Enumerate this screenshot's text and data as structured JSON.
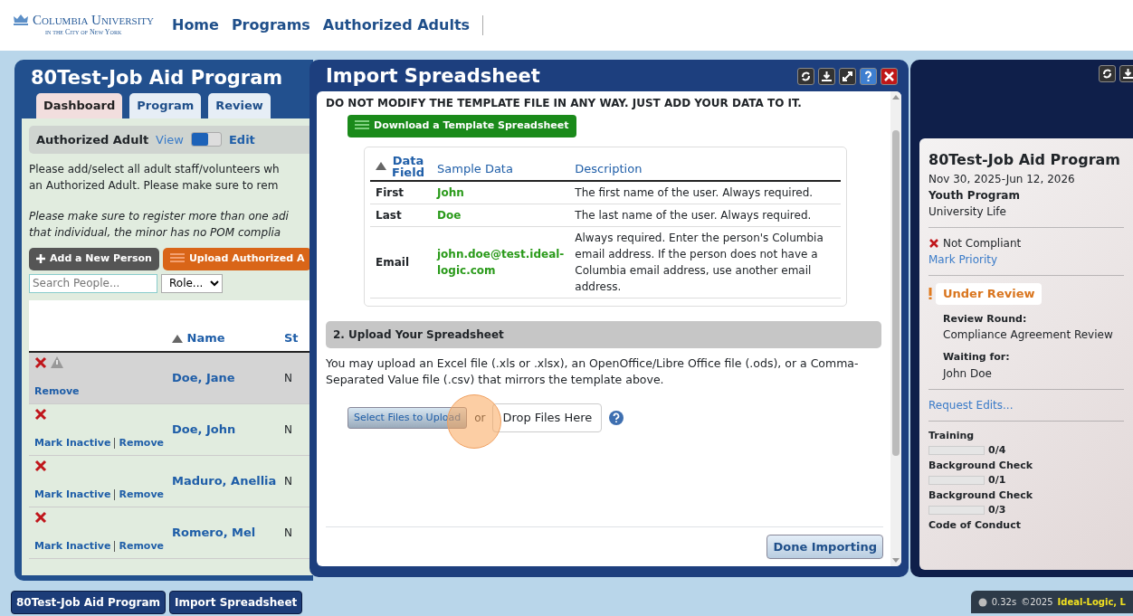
{
  "header": {
    "logo_name": "Columbia University",
    "logo_sub": "in the City of New York",
    "nav": [
      "Home",
      "Programs",
      "Authorized Adults"
    ]
  },
  "program_window": {
    "title": "80Test-Job Aid Program",
    "tabs": [
      {
        "label": "Dashboard",
        "selected": true
      },
      {
        "label": "Program",
        "selected": false
      },
      {
        "label": "Review",
        "selected": false
      }
    ],
    "section_title": "Authorized Adult",
    "toggle": {
      "left_label": "View",
      "right_label": "Edit",
      "on": false
    },
    "intro": "Please add/select all adult staff/volunteers wh\nan Authorized Adult. Please make sure to rem",
    "note": "Please make sure to register more than one adi\nthat individual, the minor has no POM complia",
    "buttons": [
      {
        "label": "Add a New Person",
        "kind": "add"
      },
      {
        "label": "Upload Authorized A",
        "kind": "upload"
      }
    ],
    "search": {
      "placeholder": "Search People..."
    },
    "role_select": "Role...",
    "columns": [
      "Name",
      "St"
    ],
    "rows": [
      {
        "name": "Doe, Jane",
        "column_3": "N",
        "warning": true,
        "actions": [
          "Remove"
        ],
        "selected": true
      },
      {
        "name": "Doe, John",
        "column_3": "N",
        "warning": false,
        "actions": [
          "Mark Inactive",
          "Remove"
        ],
        "selected": false
      },
      {
        "name": "Maduro, Anellia",
        "column_3": "N",
        "warning": false,
        "actions": [
          "Mark Inactive",
          "Remove"
        ],
        "selected": false
      },
      {
        "name": "Romero, Mel",
        "column_3": "N",
        "warning": false,
        "actions": [
          "Mark Inactive",
          "Remove"
        ],
        "selected": false
      }
    ]
  },
  "import_dialog": {
    "title": "Import Spreadsheet",
    "warning": "DO NOT MODIFY THE TEMPLATE FILE IN ANY WAY. JUST ADD YOUR DATA TO IT.",
    "download_button": "Download a Template Spreadsheet",
    "table": {
      "columns": [
        "Data Field",
        "Sample Data",
        "Description"
      ],
      "rows": [
        {
          "field": "First",
          "sample": "John",
          "description": "The first name of the user. Always required."
        },
        {
          "field": "Last",
          "sample": "Doe",
          "description": "The last name of the user. Always required."
        },
        {
          "field": "Email",
          "sample": "john.doe@test.ideal-logic.com",
          "description": "Always required. Enter the person's Columbia email address. If the person does not have a Columbia email address, use another email address."
        }
      ]
    },
    "step_title": "2. Upload Your Spreadsheet",
    "step_text": "You may upload an Excel file (.xls or .xlsx), an OpenOffice/Libre Office file (.ods), or a Comma-Separated Value file (.csv) that mirrors the template above.",
    "select_button": "Select Files to Upload",
    "or": "or",
    "drop_zone": "Drop Files Here",
    "done_button": "Done Importing"
  },
  "summary_window": {
    "program": "80Test-Job Aid Program",
    "dates": "Nov 30, 2025-Jun 12, 2026",
    "type": "Youth Program",
    "department": "University Life",
    "compliance": "Not Compliant",
    "mark_priority": "Mark Priority",
    "status": "Under Review",
    "review_round_label": "Review Round:",
    "review_round": "Compliance Agreement Review",
    "waiting_label": "Waiting for:",
    "waiting": "John Doe",
    "request_edits": "Request Edits...",
    "requirements": [
      {
        "name": "Training",
        "level": 0,
        "count": "0/4"
      },
      {
        "name": "Background Check",
        "level": 0,
        "count": "0/1"
      },
      {
        "name": "Background Check",
        "level": 0,
        "count": "0/3"
      }
    ],
    "last_requirement": "Code of Conduct"
  },
  "taskbar": {
    "windows": [
      "80Test-Job Aid Program",
      "Import Spreadsheet"
    ],
    "timing": "0.32s",
    "copyright": "©2025",
    "company": "Ideal-Logic, L"
  }
}
